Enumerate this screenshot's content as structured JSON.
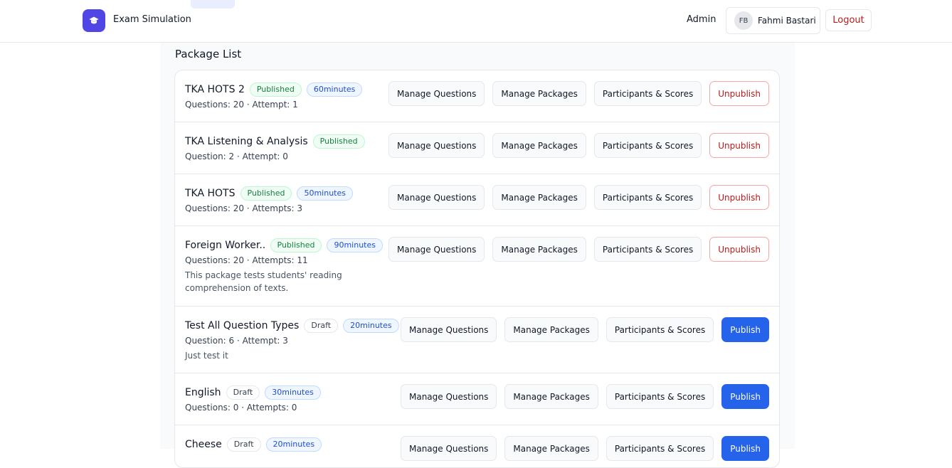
{
  "header": {
    "app_name": "Exam Simulation",
    "nav_admin": "Admin",
    "user_initials": "FB",
    "user_name": "Fahmi Bastari",
    "logout_label": "Logout"
  },
  "page": {
    "title": "Package List"
  },
  "actions": {
    "manage_questions": "Manage Questions",
    "manage_packages": "Manage Packages",
    "participants_scores": "Participants & Scores",
    "unpublish": "Unpublish",
    "publish": "Publish"
  },
  "packages": [
    {
      "name": "TKA HOTS 2",
      "status": "Published",
      "duration": "60minutes",
      "meta": "Questions: 20 · Attempt: 1",
      "description": ""
    },
    {
      "name": "TKA Listening & Analysis",
      "status": "Published",
      "duration": "",
      "meta": "Question: 2 · Attempt: 0",
      "description": ""
    },
    {
      "name": "TKA HOTS",
      "status": "Published",
      "duration": "50minutes",
      "meta": "Questions: 20 · Attempts: 3",
      "description": ""
    },
    {
      "name": "Foreign Worker...",
      "status": "Published",
      "duration": "90minutes",
      "meta": "Questions: 20 · Attempts: 11",
      "description": "This package tests students' reading comprehension of texts."
    },
    {
      "name": "Test All Question Types",
      "status": "Draft",
      "duration": "20minutes",
      "meta": "Question: 6 · Attempt: 3",
      "description": "Just test it"
    },
    {
      "name": "English",
      "status": "Draft",
      "duration": "30minutes",
      "meta": "Questions: 0 · Attempts: 0",
      "description": ""
    },
    {
      "name": "Cheese",
      "status": "Draft",
      "duration": "20minutes",
      "meta": "",
      "description": ""
    }
  ]
}
